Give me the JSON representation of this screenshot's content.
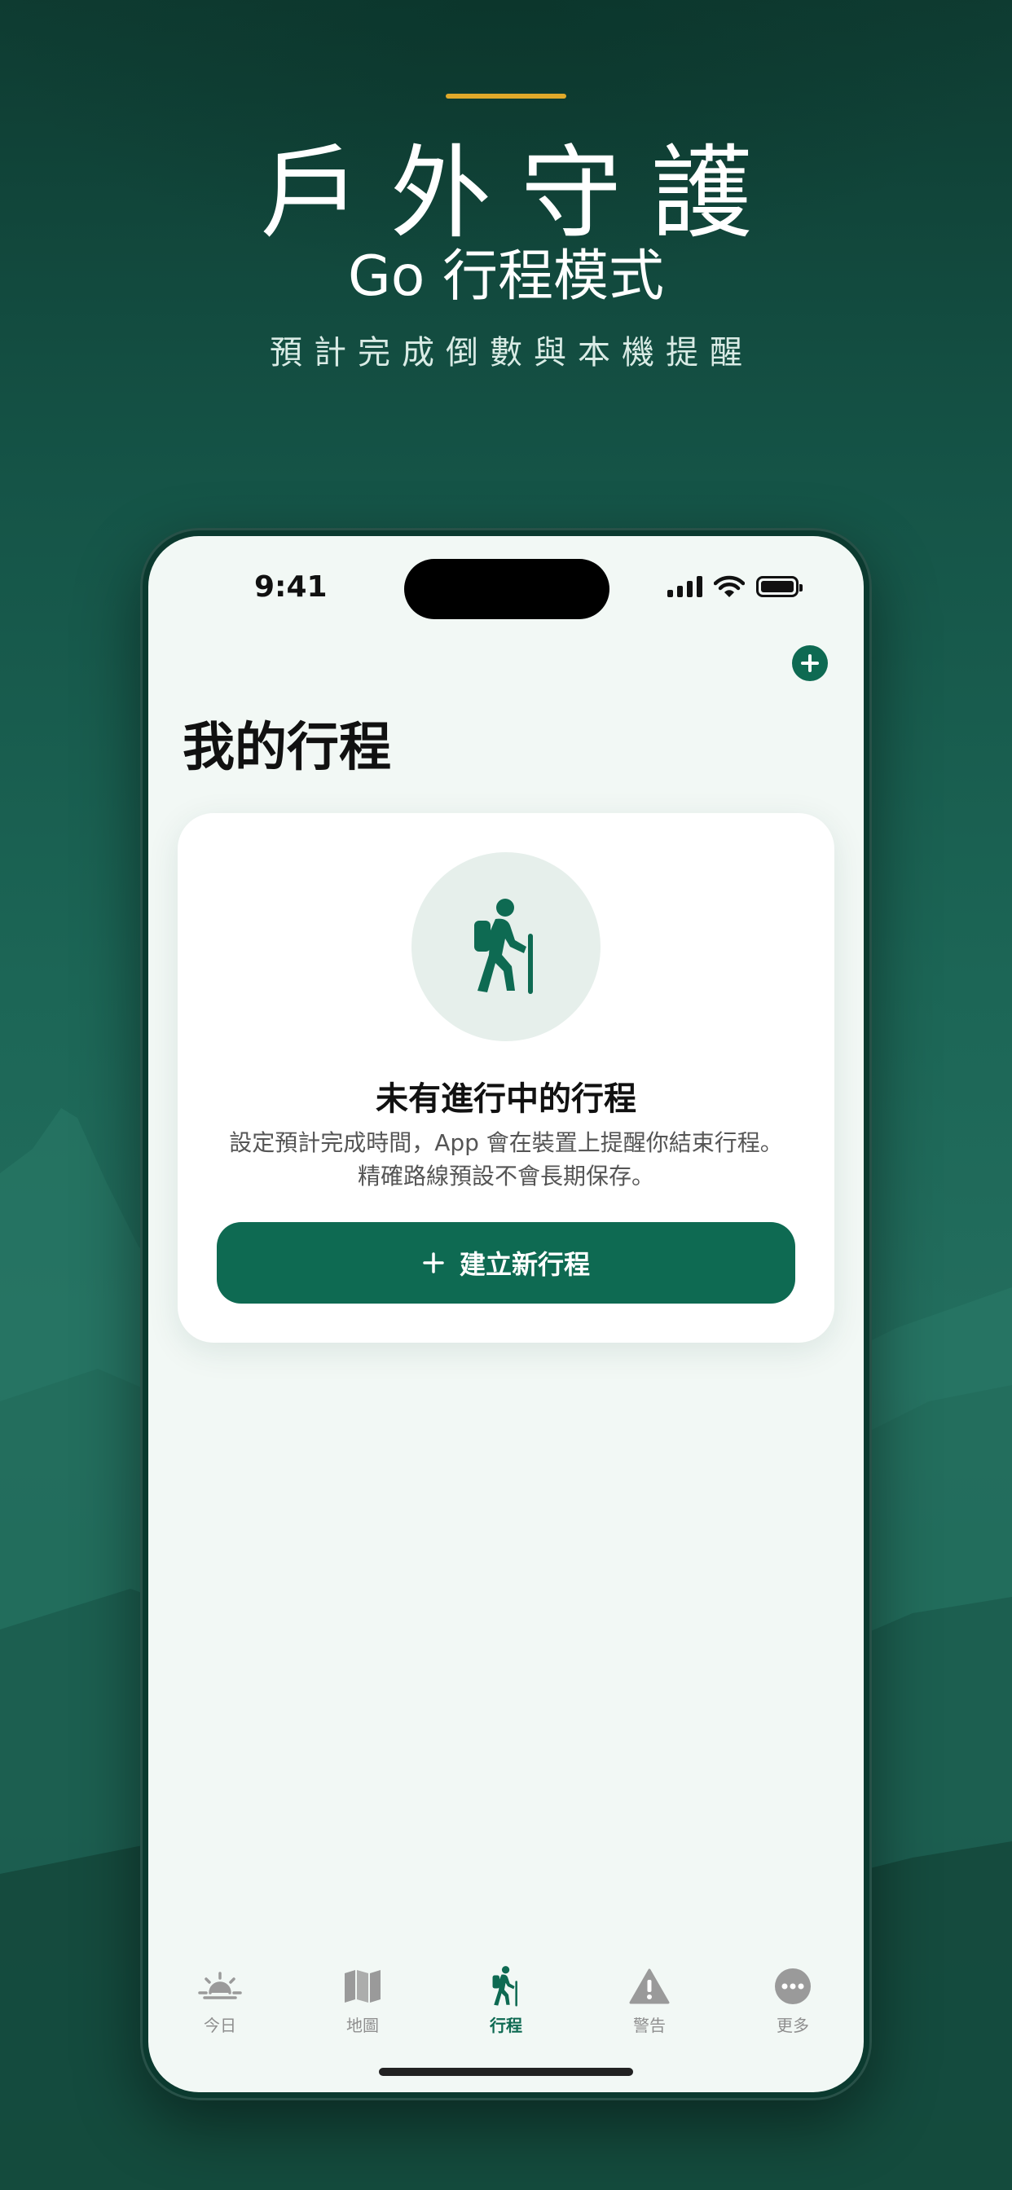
{
  "hero": {
    "title": "戶外守護",
    "subtitle": "Go 行程模式",
    "tagline": "預計完成倒數與本機提醒"
  },
  "status_bar": {
    "time": "9:41",
    "icons": [
      "cellular-signal-icon",
      "wifi-icon",
      "battery-icon"
    ]
  },
  "header": {
    "title": "我的行程",
    "add_icon": "plus-circle-icon"
  },
  "empty_state": {
    "icon": "hiker-icon",
    "title": "未有進行中的行程",
    "description_line1": "設定預計完成時間，App 會在裝置上提醒你結束行程。",
    "description_line2": "精確路線預設不會長期保存。",
    "button_label": "建立新行程"
  },
  "tabs": [
    {
      "label": "今日",
      "icon": "sunrise-icon",
      "active": false
    },
    {
      "label": "地圖",
      "icon": "map-icon",
      "active": false
    },
    {
      "label": "行程",
      "icon": "hiker-icon",
      "active": true
    },
    {
      "label": "警告",
      "icon": "warning-triangle-icon",
      "active": false
    },
    {
      "label": "更多",
      "icon": "more-ellipsis-icon",
      "active": false
    }
  ],
  "colors": {
    "accent_gold": "#e0a92a",
    "brand_green": "#0e6a52",
    "background_teal": "#1c6656",
    "screen_bg": "#f2f8f5"
  }
}
